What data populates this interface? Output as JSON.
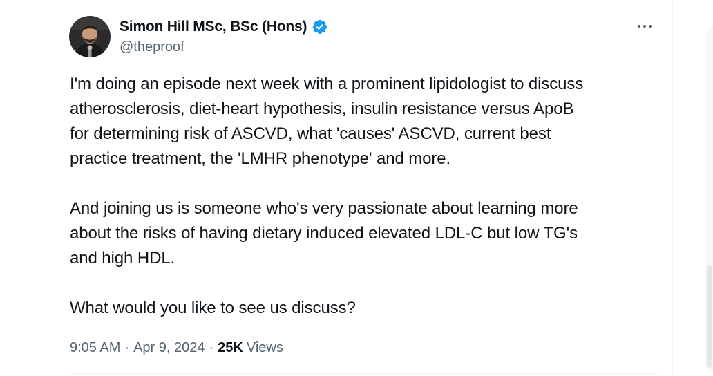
{
  "author": {
    "display_name": "Simon Hill MSc, BSc (Hons)",
    "handle": "@theproof",
    "verified": true
  },
  "tweet": {
    "paragraphs": [
      "I'm doing an episode next week with a prominent lipidologist to discuss\natherosclerosis, diet-heart hypothesis, insulin resistance versus ApoB\nfor determining risk of ASCVD, what  'causes' ASCVD, current best\npractice treatment, the 'LMHR phenotype' and more.",
      "And joining us is someone who's very passionate about learning more\nabout the risks of having dietary induced elevated LDL-C but low TG's\nand high HDL.",
      "What would you like to see us discuss?"
    ]
  },
  "meta": {
    "time": "9:05 AM",
    "separator": "·",
    "date": "Apr 9, 2024",
    "views_count": "25K",
    "views_label": "Views"
  },
  "colors": {
    "text": "#0f1419",
    "secondary": "#536471",
    "verified_blue": "#1d9bf0",
    "border": "#eff3f4"
  },
  "icons": {
    "verified": "verified-badge-icon",
    "more": "more-options-icon"
  }
}
